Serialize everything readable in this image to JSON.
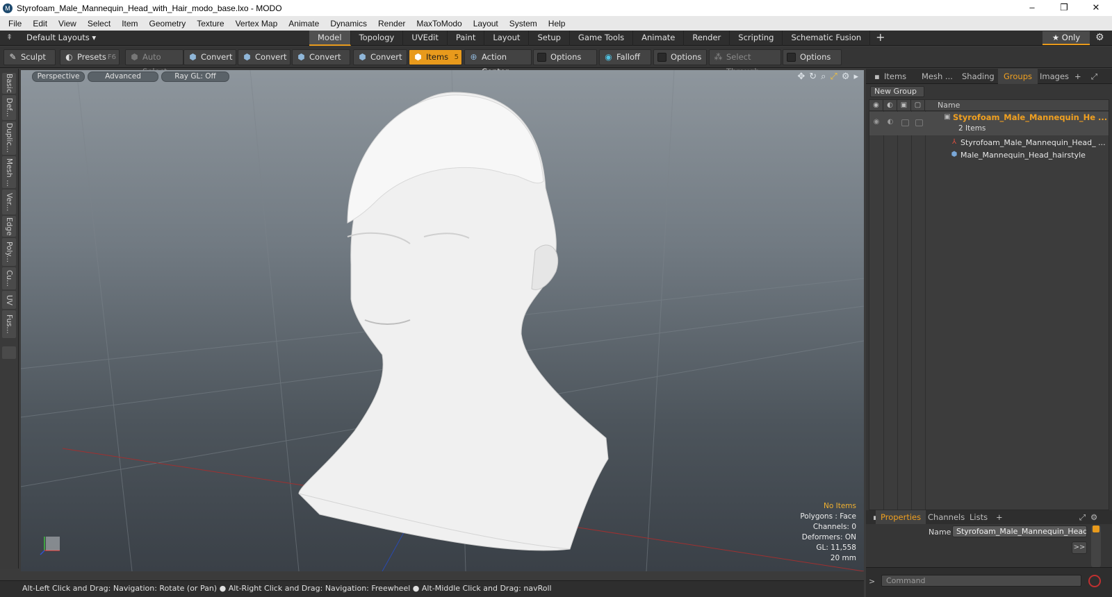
{
  "window": {
    "title": "Styrofoam_Male_Mannequin_Head_with_Hair_modo_base.lxo - MODO",
    "min": "–",
    "max": "❐",
    "close": "✕"
  },
  "menu": [
    "File",
    "Edit",
    "View",
    "Select",
    "Item",
    "Geometry",
    "Texture",
    "Vertex Map",
    "Animate",
    "Dynamics",
    "Render",
    "MaxToModo",
    "Layout",
    "System",
    "Help"
  ],
  "layout": {
    "default_layouts": "Default Layouts ▾",
    "tabs": [
      "Model",
      "Topology",
      "UVEdit",
      "Paint",
      "Layout",
      "Setup",
      "Game Tools",
      "Animate",
      "Render",
      "Scripting",
      "Schematic Fusion"
    ],
    "active_tab": "Model",
    "plus": "+",
    "only": "★  Only"
  },
  "toolbar": {
    "sculpt": "Sculpt",
    "presets": "Presets",
    "presets_key": "F6",
    "auto_select": "Auto Select",
    "convert1": "Convert",
    "convert2": "Convert",
    "convert3": "Convert",
    "convert4": "Convert",
    "items": "Items",
    "items_key": "5",
    "action_center": "Action Center",
    "options1": "Options",
    "falloff": "Falloff",
    "options2": "Options",
    "select_through": "Select Through",
    "options3": "Options"
  },
  "left_tabs": [
    "Basic",
    "Def...",
    "Duplic...",
    "Mesh ...",
    "Ver...",
    "Edge",
    "Poly...",
    "Cu...",
    "UV",
    "Fus..."
  ],
  "viewport": {
    "perspective": "Perspective",
    "advanced": "Advanced",
    "raygl": "Ray GL: Off",
    "stats": {
      "no_items": "No Items",
      "polygons": "Polygons : Face",
      "channels": "Channels: 0",
      "deformers": "Deformers: ON",
      "gl": "GL: 11,558",
      "scale": "20 mm"
    }
  },
  "status": "Alt-Left Click and Drag: Navigation: Rotate (or Pan) ● Alt-Right Click and Drag: Navigation: Freewheel ● Alt-Middle Click and Drag: navRoll",
  "right_tabs": [
    "Items",
    "Mesh ...",
    "Shading",
    "Groups",
    "Images"
  ],
  "right_active": "Groups",
  "groups": {
    "new_group": "New Group",
    "name_col": "Name",
    "group_name": "Styrofoam_Male_Mannequin_He ...",
    "group_count": "2 Items",
    "child1": "Styrofoam_Male_Mannequin_Head_ ...",
    "child2": "Male_Mannequin_Head_hairstyle"
  },
  "props": {
    "tabs": [
      "Properties",
      "Channels",
      "Lists"
    ],
    "active": "Properties",
    "name_label": "Name",
    "name_value": "Styrofoam_Male_Mannequin_Head_wit",
    "expand": ">>",
    "command_placeholder": "Command"
  }
}
